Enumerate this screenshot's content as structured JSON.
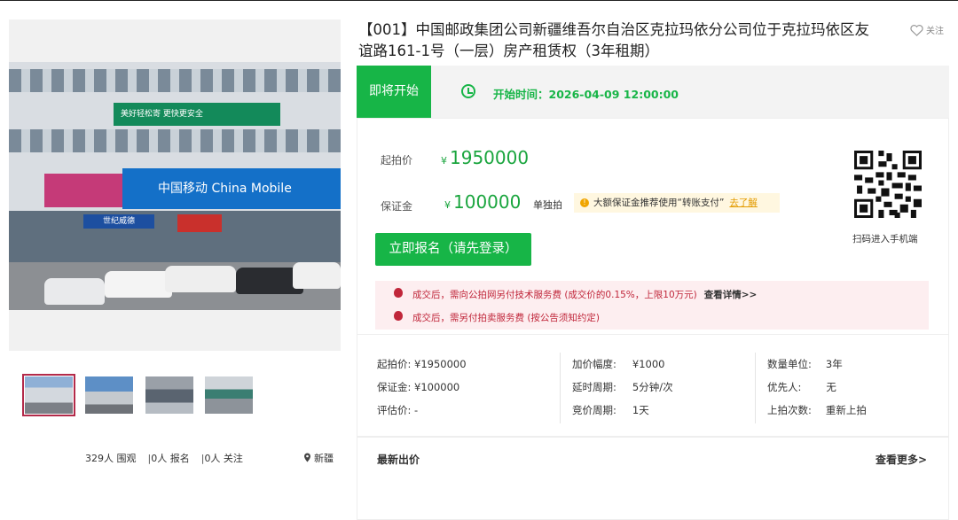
{
  "gallery": {
    "photo_alt": "",
    "photo_banner_green": "美好轻松寄 更快更安全",
    "photo_banner_blue": "中国移动 China Mobile",
    "photo_shop_sign": "世纪威德",
    "thumbnail_count": 4
  },
  "stats": {
    "views": "329人 围观",
    "signups": "0人 报名",
    "follows": "0人 关注",
    "location": "新疆",
    "sep": "|"
  },
  "title": "【001】中国邮政集团公司新疆维吾尔自治区克拉玛依分公司位于克拉玛依区友谊路161-1号（一层）房产租赁权（3年租期）",
  "follow_label": "关注",
  "status": {
    "tag": "即将开始",
    "start_time": "开始时间：2026-04-09 12:00:00"
  },
  "price": {
    "start_label": "起拍价",
    "start_value": "1950000",
    "deposit_label": "保证金",
    "deposit_value": "100000",
    "yen": "¥",
    "solo": "单独拍",
    "tip": "大额保证金推荐使用“转账支付”",
    "tip_link": "去了解",
    "signup_button": "立即报名（请先登录）",
    "qr_text": "扫码进入手机端"
  },
  "notices": [
    {
      "text": "成交后，需向公拍网另付技术服务费 (成交价的0.15%，上限10万元)",
      "link": "查看详情>>"
    },
    {
      "text": "成交后，需另付拍卖服务费 (按公告须知约定)"
    }
  ],
  "details": {
    "col1": [
      {
        "k": "起拍价:",
        "v": "¥1950000"
      },
      {
        "k": "保证金:",
        "v": "¥100000"
      },
      {
        "k": "评估价:",
        "v": "-"
      }
    ],
    "col2": [
      {
        "k": "加价幅度:",
        "v": "¥1000"
      },
      {
        "k": "延时周期:",
        "v": "5分钟/次"
      },
      {
        "k": "竞价周期:",
        "v": "1天"
      }
    ],
    "col3": [
      {
        "k": "数量单位:",
        "v": "3年"
      },
      {
        "k": "优先人:",
        "v": "无"
      },
      {
        "k": "上拍次数:",
        "v": "重新上拍"
      }
    ]
  },
  "latest": {
    "title": "最新出价",
    "more": "查看更多>"
  },
  "colors": {
    "accent_green": "#17b547",
    "notice_red": "#c0263a",
    "tip_orange": "#e39b00"
  }
}
